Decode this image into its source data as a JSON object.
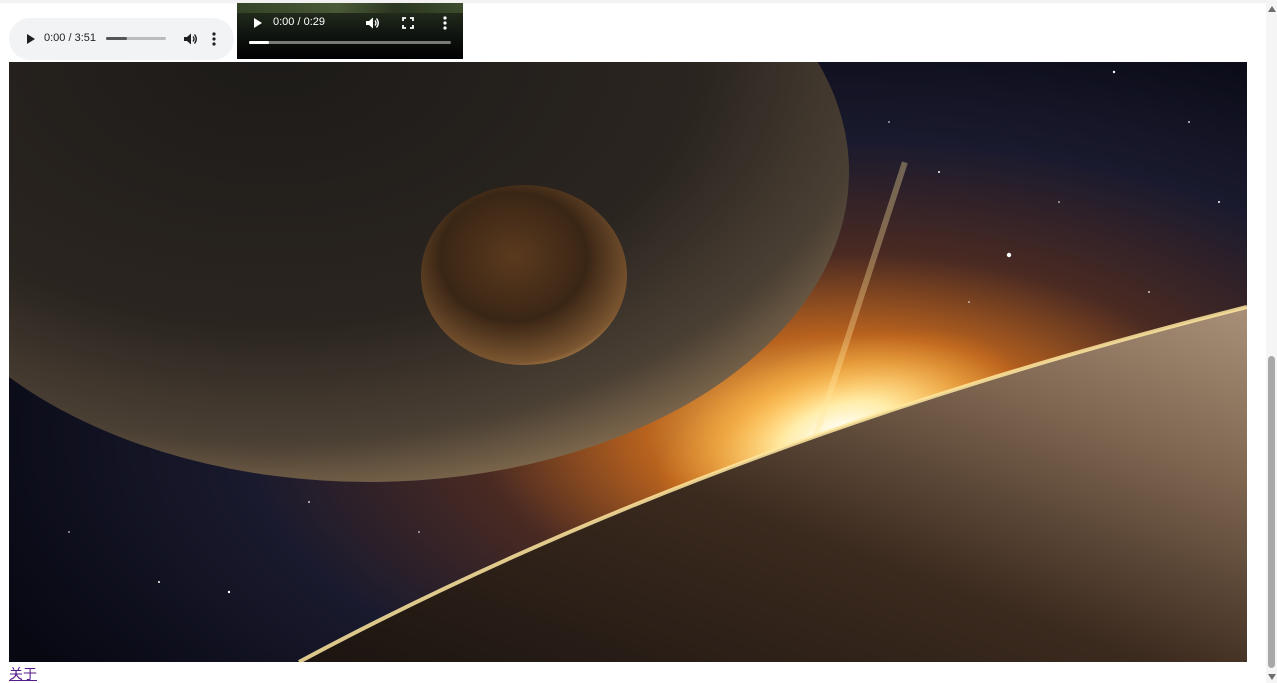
{
  "audio": {
    "time": "0:00 / 3:51",
    "volume_level": 0.35,
    "controls": {
      "play_icon": "play-icon",
      "volume_icon": "volume-icon",
      "menu_icon": "more-vert-icon"
    }
  },
  "video": {
    "time": "0:00 / 0:29",
    "progress": 0.1,
    "controls": {
      "play_icon": "play-icon",
      "volume_icon": "volume-icon",
      "fullscreen_icon": "fullscreen-icon",
      "menu_icon": "more-vert-icon"
    }
  },
  "image": {
    "subject": "space-planets-sunrise"
  },
  "link": {
    "about": "关于"
  },
  "colors": {
    "link": "#551a8b",
    "audio_bg": "#f1f3f4",
    "video_bg": "#000000"
  }
}
